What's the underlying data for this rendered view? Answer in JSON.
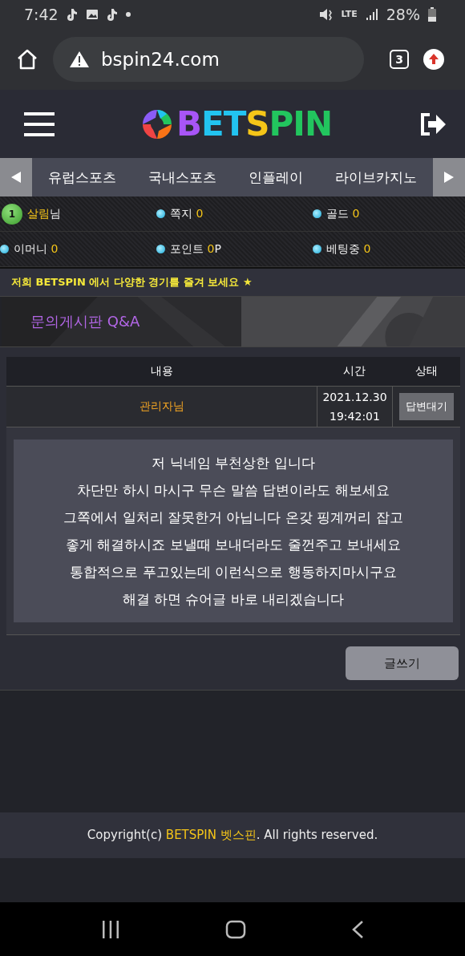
{
  "status_bar": {
    "time": "7:42",
    "network": "LTE",
    "battery": "28%"
  },
  "browser": {
    "url": "bspin24.com",
    "tab_count": "3"
  },
  "logo": {
    "parts": [
      {
        "text": "B",
        "color": "#a855f7"
      },
      {
        "text": "E",
        "color": "#22c3f0"
      },
      {
        "text": "T",
        "color": "#22c3f0"
      },
      {
        "text": "S",
        "color": "#f5c518"
      },
      {
        "text": "PIN",
        "color": "#22c55e"
      }
    ]
  },
  "nav_tabs": [
    {
      "label": "유럽스포츠"
    },
    {
      "label": "국내스포츠"
    },
    {
      "label": "인플레이"
    },
    {
      "label": "라이브카지노"
    }
  ],
  "user": {
    "level": "1",
    "name": "살림",
    "honorific": "님"
  },
  "stats": [
    {
      "label": "쪽지",
      "value": "0"
    },
    {
      "label": "골드",
      "value": "0"
    },
    {
      "label": "이머니",
      "value": "0"
    },
    {
      "label": "포인트",
      "value": "0",
      "unit": "P"
    },
    {
      "label": "베팅중",
      "value": "0"
    }
  ],
  "notice": "저희 BETSPIN 에서 다양한 경기를 즐겨 보세요 ★",
  "board": {
    "title": "문의게시판 Q&A",
    "kind": "picture"
  },
  "table": {
    "columns": [
      "내용",
      "시간",
      "상태"
    ],
    "rows": [
      {
        "author": "관리자님",
        "date": "2021.12.30",
        "time": "19:42:01",
        "status": "답변대기",
        "body": [
          "저 닉네임 부천상한 입니다",
          "차단만 하시 마시구 무슨 말씀 답변이라도 해보세요",
          "그쪽에서 일처리 잘못한거 아닙니다 온갖 핑계꺼리 잡고",
          "좋게 해결하시죠 보낼때 보내더라도 줄껀주고 보내세요",
          "통합적으로 푸고있는데 이런식으로 행동하지마시구요",
          "해결 하면 슈어글 바로 내리겠습니다"
        ]
      }
    ]
  },
  "write_button": "글쓰기",
  "footer": {
    "parts": [
      {
        "text": "Copyright(c) ",
        "highlight": false
      },
      {
        "text": "BETSPIN 벳스핀",
        "highlight": true
      },
      {
        "text": ". All rights reserved.",
        "highlight": false
      }
    ]
  }
}
